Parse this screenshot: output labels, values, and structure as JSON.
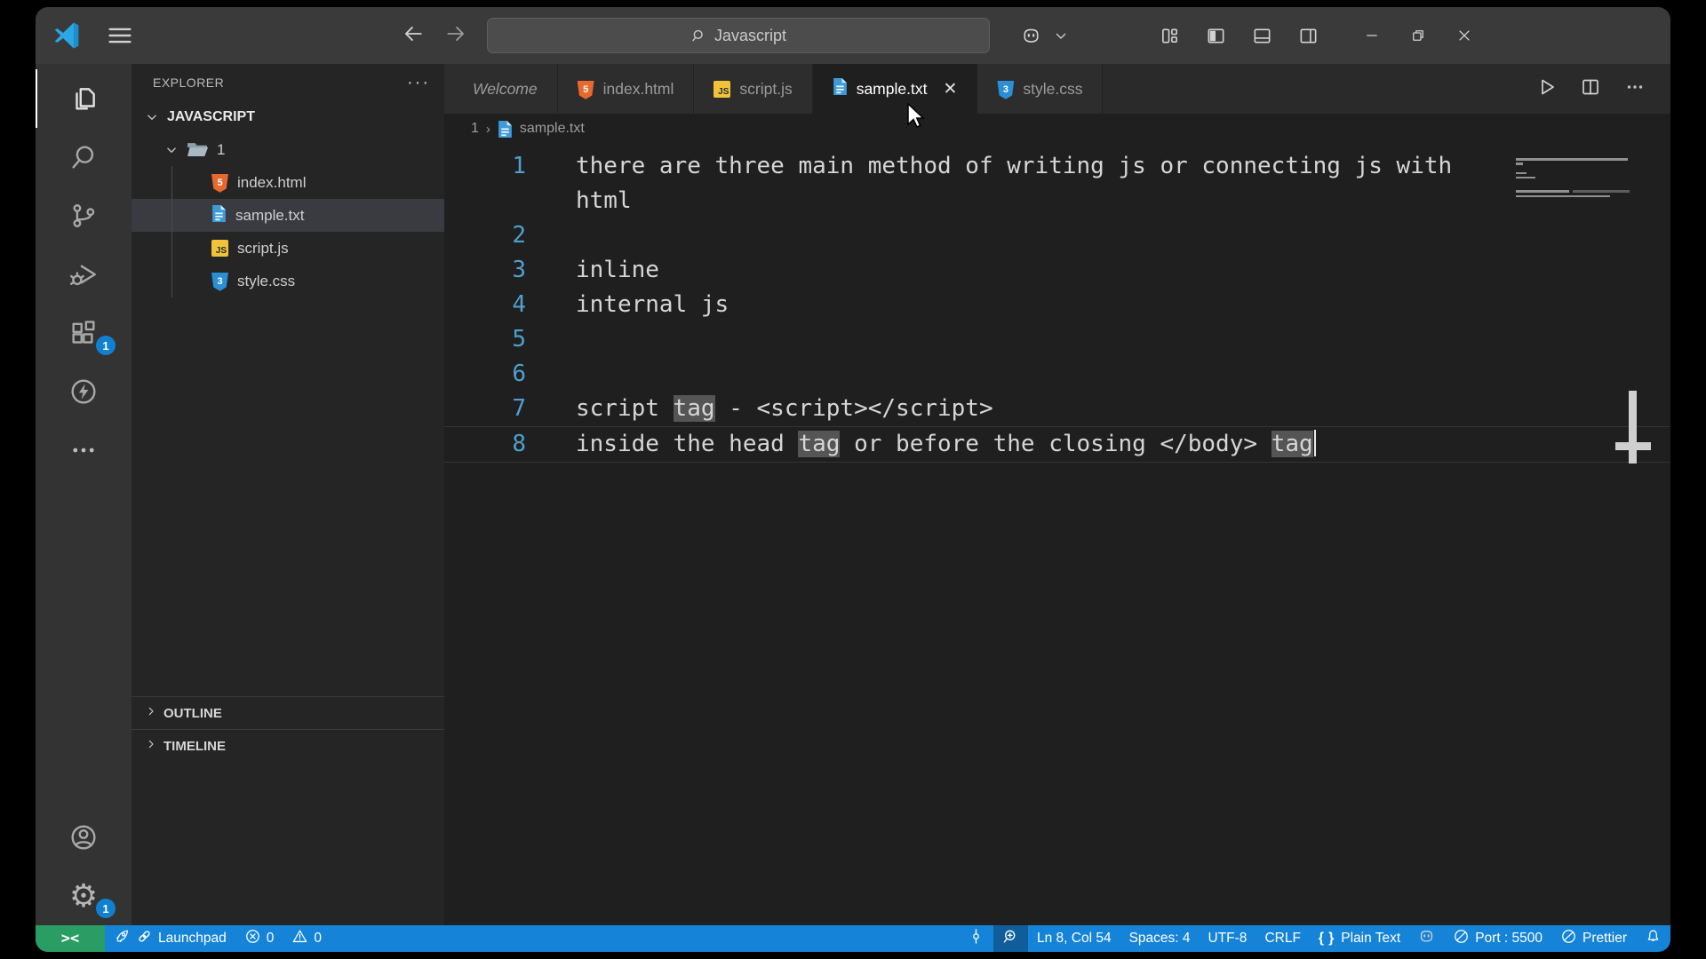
{
  "titlebar": {
    "search_value": "Javascript",
    "menu_icon": "menu-icon",
    "logo_icon": "vscode-icon",
    "nav": {
      "back_icon": "arrow-left-icon",
      "forward_icon": "arrow-right-icon"
    },
    "right_icons": [
      "copilot-icon",
      "chevron-down-icon"
    ],
    "layout_icons": [
      "layout-customize-icon",
      "layout-sidebar-icon",
      "layout-panel-icon",
      "layout-secondary-icon"
    ],
    "window_controls": [
      "minimize-icon",
      "restore-icon",
      "close-icon"
    ]
  },
  "activity_bar": {
    "top": [
      {
        "icon": "files-icon",
        "active": true
      },
      {
        "icon": "search-icon"
      },
      {
        "icon": "source-control-icon"
      },
      {
        "icon": "run-debug-icon"
      },
      {
        "icon": "extensions-icon",
        "badge": "1"
      },
      {
        "icon": "thunder-icon"
      },
      {
        "icon": "more-icon"
      }
    ],
    "bottom": [
      {
        "icon": "account-icon"
      },
      {
        "icon": "gear-icon",
        "badge": "1"
      }
    ]
  },
  "sidebar": {
    "title": "EXPLORER",
    "more_label": "···",
    "workspace": "JAVASCRIPT",
    "folder": "1",
    "files": [
      {
        "name": "index.html",
        "icon": "html-icon"
      },
      {
        "name": "sample.txt",
        "icon": "txt-icon",
        "selected": true
      },
      {
        "name": "script.js",
        "icon": "js-icon"
      },
      {
        "name": "style.css",
        "icon": "css-icon"
      }
    ],
    "sections": [
      "OUTLINE",
      "TIMELINE"
    ]
  },
  "tabs": [
    {
      "label": "Welcome",
      "icon": "vscode-icon",
      "italic": true
    },
    {
      "label": "index.html",
      "icon": "html-icon"
    },
    {
      "label": "script.js",
      "icon": "js-icon"
    },
    {
      "label": "sample.txt",
      "icon": "txt-icon",
      "active": true,
      "closable": true
    },
    {
      "label": "style.css",
      "icon": "css-icon"
    }
  ],
  "tab_actions": [
    "run-icon",
    "split-editor-icon",
    "more-icon"
  ],
  "editor": {
    "breadcrumb": {
      "folder": "1",
      "file": "sample.txt",
      "file_icon": "txt-icon"
    },
    "lines": [
      {
        "num": "1",
        "segments": [
          {
            "text": "there are three main method of writing js or connecting js with html"
          }
        ],
        "wrap_at": 64
      },
      {
        "num": "2",
        "segments": []
      },
      {
        "num": "3",
        "segments": [
          {
            "text": "inline"
          }
        ]
      },
      {
        "num": "4",
        "segments": [
          {
            "text": "internal js"
          }
        ]
      },
      {
        "num": "5",
        "segments": []
      },
      {
        "num": "6",
        "segments": []
      },
      {
        "num": "7",
        "segments": [
          {
            "text": "script "
          },
          {
            "text": "tag",
            "highlight": true
          },
          {
            "text": " - <script></script>"
          }
        ],
        "overview": true
      },
      {
        "num": "8",
        "segments": [
          {
            "text": "inside the head "
          },
          {
            "text": "tag",
            "highlight": true
          },
          {
            "text": " or before the closing </body> "
          },
          {
            "text": "tag",
            "highlight": true,
            "cursor_after": true
          }
        ],
        "current": true
      }
    ]
  },
  "status_bar": {
    "left": [
      {
        "name": "remote-indicator",
        "icons": [
          "remote-icon"
        ],
        "cls": "remote"
      },
      {
        "name": "launchpad",
        "icons": [
          "rocket-icon",
          "link-icon"
        ],
        "label": "Launchpad"
      },
      {
        "name": "problems-errors",
        "icons": [
          "error-icon"
        ],
        "label": "0"
      },
      {
        "name": "problems-warnings",
        "icons": [
          "warning-icon"
        ],
        "label": "0"
      }
    ],
    "right": [
      {
        "name": "ports-forward",
        "icons": [
          "port-forward-icon"
        ]
      },
      {
        "name": "screencast-zoom",
        "icons": [
          "zoom-in-icon"
        ],
        "cls": "active"
      },
      {
        "name": "cursor-position",
        "label": "Ln 8, Col 54"
      },
      {
        "name": "indentation",
        "label": "Spaces: 4"
      },
      {
        "name": "encoding",
        "label": "UTF-8"
      },
      {
        "name": "eol-sequence",
        "label": "CRLF"
      },
      {
        "name": "language-mode",
        "icons": [
          "braces-icon"
        ],
        "label": "Plain Text"
      },
      {
        "name": "copilot-status",
        "icons": [
          "copilot-icon"
        ]
      },
      {
        "name": "live-server-port",
        "icons": [
          "blocked-icon"
        ],
        "label": "Port : 5500"
      },
      {
        "name": "prettier",
        "icons": [
          "blocked-icon"
        ],
        "label": "Prettier"
      },
      {
        "name": "notifications",
        "icons": [
          "bell-icon"
        ]
      }
    ]
  },
  "colors": {
    "status_bar": "#1583d7",
    "remote_green": "#2a9d64",
    "badge_blue": "#1080d0",
    "accent_blue": "#2aa7e4",
    "line_number": "#4fa0d0"
  }
}
